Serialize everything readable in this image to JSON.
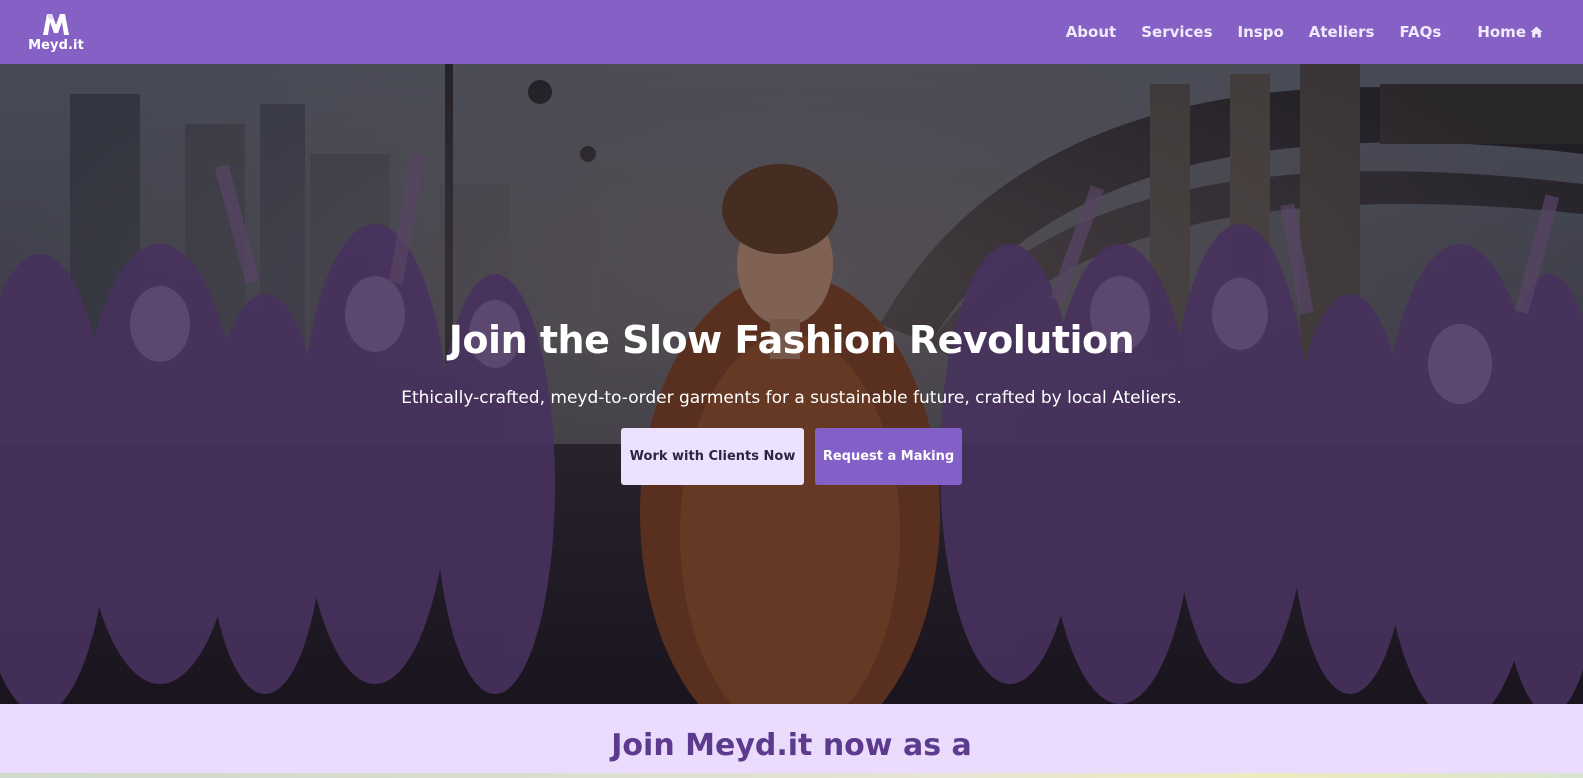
{
  "brand": {
    "name": "Meyd.it",
    "logo_icon": "m-logo-icon"
  },
  "nav": {
    "items": [
      {
        "label": "About"
      },
      {
        "label": "Services"
      },
      {
        "label": "Inspo"
      },
      {
        "label": "Ateliers"
      },
      {
        "label": "FAQs"
      }
    ],
    "home": {
      "label": "Home",
      "icon": "home-icon"
    }
  },
  "hero": {
    "title": "Join the Slow Fashion Revolution",
    "subtitle": "Ethically-crafted, meyd-to-order garments for a sustainable future, crafted by local Ateliers.",
    "primary_button": "Work with Clients Now",
    "secondary_button": "Request a Making"
  },
  "join": {
    "title": "Join Meyd.it now as a"
  },
  "colors": {
    "navbar": "#8561c6",
    "accent_purple": "#8360c8",
    "light_lavender": "#ebdcfd",
    "heading_purple": "#5c3b8e"
  }
}
